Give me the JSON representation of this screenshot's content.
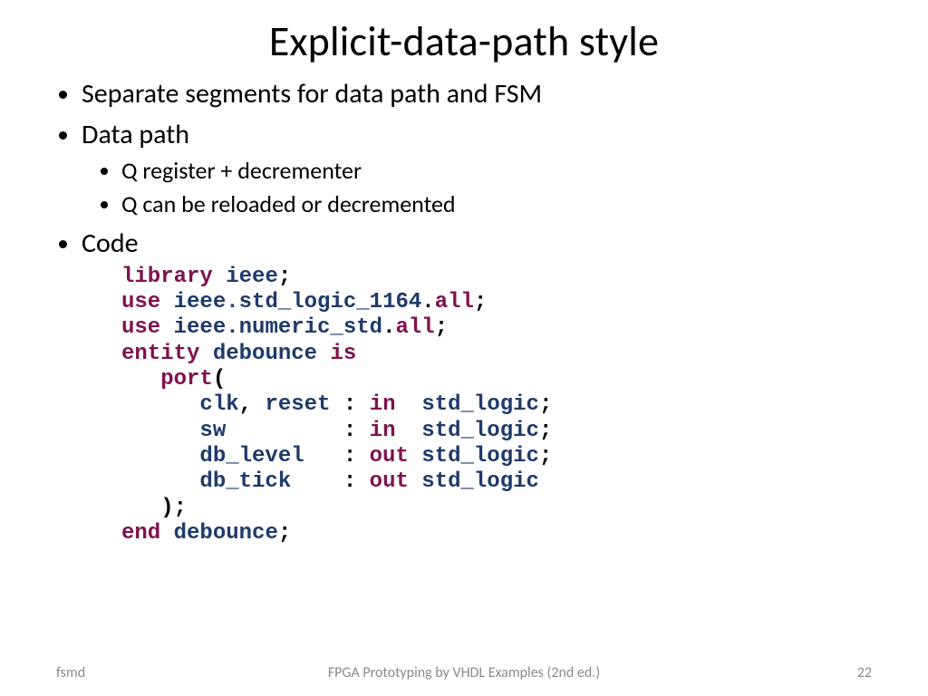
{
  "title": "Explicit-data-path style",
  "bullets": {
    "b1": "Separate segments for data path and FSM",
    "b2": "Data path",
    "b2a": "Q register + decrementer",
    "b2b": "Q can be reloaded or decremented",
    "b3": "Code"
  },
  "code": {
    "kw_library": "library",
    "id_ieee": "ieee",
    "kw_use": "use",
    "id_std_logic_1164": "ieee.std_logic_1164",
    "kw_all": "all",
    "id_numeric_std": "ieee.numeric_std",
    "kw_entity": "entity",
    "id_debounce": "debounce",
    "kw_is": "is",
    "kw_port": "port",
    "id_clk": "clk",
    "id_reset": "reset",
    "kw_in": "in",
    "id_std_logic": "std_logic",
    "id_sw": "sw",
    "id_db_level": "db_level",
    "kw_out": "out",
    "id_db_tick": "db_tick",
    "kw_end": "end"
  },
  "footer": {
    "left": "fsmd",
    "center": "FPGA Prototyping by VHDL Examples (2nd ed.)",
    "right": "22"
  }
}
